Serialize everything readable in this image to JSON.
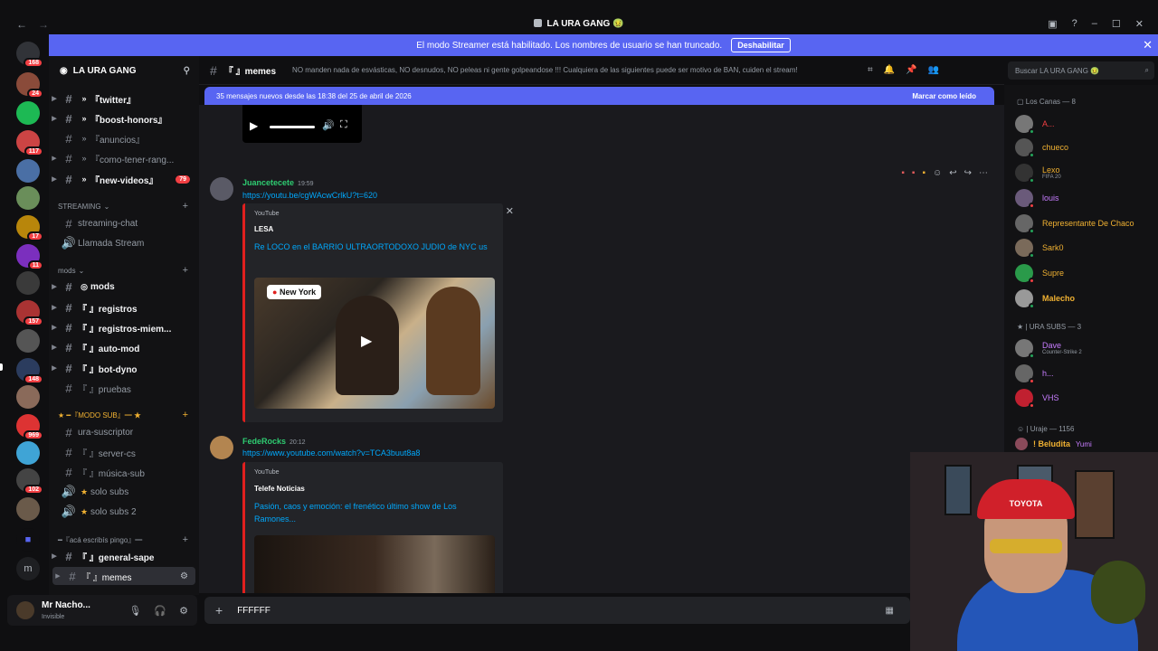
{
  "window": {
    "title": "LA URA GANG"
  },
  "streamer_banner": {
    "text": "El modo Streamer está habilitado. Los nombres de usuario se han truncado.",
    "button": "Deshabilitar"
  },
  "server_badges": [
    "168",
    "24",
    "117",
    "17",
    "11",
    "157",
    "148",
    "969",
    "102"
  ],
  "server": {
    "name": "LA URA GANG"
  },
  "channels": {
    "top": [
      {
        "name": "『twitter』",
        "icon": "»",
        "white": true
      },
      {
        "name": "『boost-honors』",
        "icon": "»",
        "white": true
      },
      {
        "name": "『anuncios』",
        "icon": "»",
        "white": false
      },
      {
        "name": "『como-tener-rang...",
        "icon": "»",
        "white": false
      },
      {
        "name": "『new-videos』",
        "icon": "»",
        "white": true,
        "count": "79"
      }
    ],
    "streaming_cat": "STREAMING",
    "streaming": [
      {
        "name": "streaming-chat"
      },
      {
        "name": "Llamada Stream"
      }
    ],
    "mods_cat": "mods",
    "mods": [
      {
        "name": "mods",
        "white": true
      },
      {
        "name": "『 』registros",
        "white": true
      },
      {
        "name": "『 』registros-miem...",
        "white": true
      },
      {
        "name": "『 』auto-mod",
        "white": true
      },
      {
        "name": "『 』bot-dyno",
        "white": true
      },
      {
        "name": "『 』pruebas",
        "white": false
      }
    ],
    "modo_cat": "★ ━『MODO SUB』━ ★",
    "modo": [
      {
        "name": "ura-suscriptor"
      },
      {
        "name": "『 』server-cs"
      },
      {
        "name": "『 』música-sub"
      },
      {
        "name": "solo subs"
      },
      {
        "name": "solo subs 2"
      }
    ],
    "aca_cat": "━『acá escribís pingo』━",
    "aca": [
      {
        "name": "『 』general-sape",
        "white": true
      },
      {
        "name": "『 』memes",
        "active": true
      }
    ]
  },
  "user_panel": {
    "name": "Mr Nacho...",
    "status": "Invisible"
  },
  "header": {
    "channel": "『 』memes",
    "topic": "NO manden nada de esvásticas, NO desnudos, NO peleas ni gente golpeandose !!! Cualquiera de las siguientes puede ser motivo de BAN, cuiden el stream!"
  },
  "search": {
    "placeholder": "Buscar LA URA GANG"
  },
  "new_messages_bar": {
    "text": "35 mensajes nuevos desde las 18:38 del 25 de abril de 2026",
    "action": "Marcar como leído"
  },
  "messages": [
    {
      "author": "Juancetecete",
      "time": "19:59",
      "link": "https://youtu.be/cgWAcwCrlkU?t=620",
      "embed": {
        "provider": "YouTube",
        "author": "LESA",
        "title": "Re LOCO en el BARRIO ULTRAORTODOXO JUDIO de NYC us",
        "tag": "New York"
      }
    },
    {
      "author": "FedeRocks",
      "time": "20:12",
      "link": "https://www.youtube.com/watch?v=TCA3buut8a8",
      "embed": {
        "provider": "YouTube",
        "author": "Telefe Noticias",
        "title": "Pasión, caos y emoción: el frenético último show de Los Ramones..."
      }
    }
  ],
  "composer": {
    "value": "FFFFFF"
  },
  "members": {
    "group1": "Los Canas — 8",
    "group1_list": [
      {
        "name": "A...",
        "color": "#f23f43",
        "sub": ""
      },
      {
        "name": "chueco",
        "color": "#f0b132",
        "sub": ""
      },
      {
        "name": "Lexo",
        "color": "#f0b132",
        "sub": "FIFA 20"
      },
      {
        "name": "louis",
        "color": "#c77dff",
        "sub": ""
      },
      {
        "name": "Representante De Chaco",
        "color": "#f0b132",
        "sub": ""
      },
      {
        "name": "Sark0",
        "color": "#f0b132",
        "sub": ""
      },
      {
        "name": "Supre",
        "color": "#f0b132",
        "sub": ""
      },
      {
        "name": "Malecho",
        "color": "#f0b132",
        "sub": ""
      }
    ],
    "group2": "★ | URA SUBS — 3",
    "group2_list": [
      {
        "name": "Dave",
        "color": "#c77dff",
        "sub": "Counter-Strike 2"
      },
      {
        "name": "h...",
        "color": "#c77dff",
        "sub": ""
      },
      {
        "name": "VHS",
        "color": "#c77dff",
        "sub": ""
      }
    ],
    "group3": "| Uraje — 1156",
    "group3_first": "! Beludita",
    "group3_first_extra": "Yumi"
  },
  "colors": {
    "accent": "#5865f2",
    "online": "#23a55a",
    "dnd": "#f23f43"
  }
}
